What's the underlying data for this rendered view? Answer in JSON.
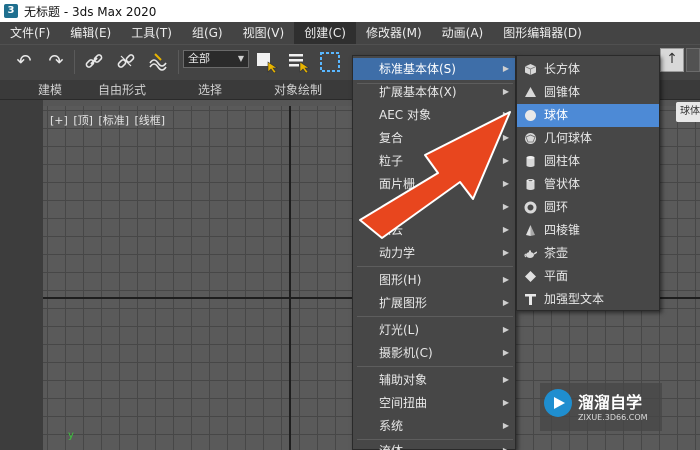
{
  "window": {
    "title": "无标题 - 3ds Max 2020",
    "app_icon": "3"
  },
  "menubar": [
    {
      "label": "文件(F)"
    },
    {
      "label": "编辑(E)"
    },
    {
      "label": "工具(T)"
    },
    {
      "label": "组(G)"
    },
    {
      "label": "视图(V)"
    },
    {
      "label": "创建(C)"
    },
    {
      "label": "修改器(M)"
    },
    {
      "label": "动画(A)"
    },
    {
      "label": "图形编辑器(D)"
    }
  ],
  "toolbar": {
    "selection_filter": "全部",
    "icons": [
      "undo-icon",
      "redo-icon",
      "link-icon",
      "unlink-icon",
      "bind-spacewarp-icon",
      "select-object-icon",
      "select-by-name-icon",
      "rectangle-selection-icon",
      "front-toolbar-icon"
    ]
  },
  "ribbon": {
    "tabs": [
      "建模",
      "自由形式",
      "选择",
      "对象绘制"
    ]
  },
  "viewport": {
    "label_parts": [
      "[+]",
      "[顶]",
      "[标准]",
      "[线框]"
    ],
    "axis_label": "y"
  },
  "create_menu": {
    "items": [
      {
        "label": "标准基本体(S)",
        "submenu": true,
        "highlighted": true
      },
      {
        "label": "扩展基本体(X)",
        "submenu": true
      },
      {
        "label": "AEC 对象",
        "submenu": true
      },
      {
        "label": "复合",
        "submenu": true
      },
      {
        "label": "粒子",
        "submenu": true
      },
      {
        "label": "面片栅",
        "submenu": true
      },
      {
        "label": "",
        "submenu": true
      },
      {
        "label": "点云",
        "submenu": true
      },
      {
        "label": "动力学",
        "submenu": true
      },
      {
        "label": "图形(H)",
        "submenu": true
      },
      {
        "label": "扩展图形",
        "submenu": true
      },
      {
        "label": "灯光(L)",
        "submenu": true
      },
      {
        "label": "摄影机(C)",
        "submenu": true
      },
      {
        "label": "辅助对象",
        "submenu": true
      },
      {
        "label": "空间扭曲",
        "submenu": true
      },
      {
        "label": "系统",
        "submenu": true
      },
      {
        "label": "流体",
        "submenu": true
      }
    ]
  },
  "primitives_menu": {
    "items": [
      {
        "label": "长方体",
        "icon": "box-icon"
      },
      {
        "label": "圆锥体",
        "icon": "cone-icon"
      },
      {
        "label": "球体",
        "icon": "sphere-icon",
        "highlighted": true
      },
      {
        "label": "几何球体",
        "icon": "geosphere-icon"
      },
      {
        "label": "圆柱体",
        "icon": "cylinder-icon"
      },
      {
        "label": "管状体",
        "icon": "tube-icon"
      },
      {
        "label": "圆环",
        "icon": "torus-icon"
      },
      {
        "label": "四棱锥",
        "icon": "pyramid-icon"
      },
      {
        "label": "茶壶",
        "icon": "teapot-icon"
      },
      {
        "label": "平面",
        "icon": "plane-icon"
      },
      {
        "label": "加强型文本",
        "icon": "text-plus-icon"
      }
    ]
  },
  "tooltip": "球体",
  "watermark": {
    "title": "溜溜自学",
    "subtitle": "ZIXUE.3D66.COM"
  },
  "colors": {
    "highlight": "#4d8ad6",
    "menu_bg": "#474747",
    "annotation_arrow": "#e8461e"
  }
}
